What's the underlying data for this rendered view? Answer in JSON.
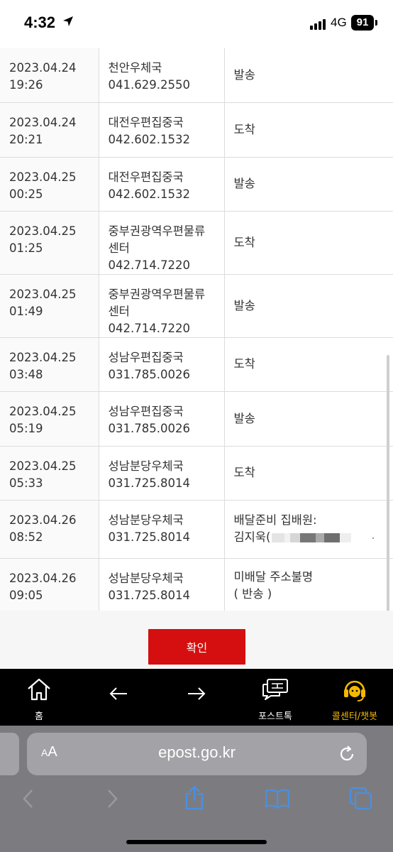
{
  "status_bar": {
    "time": "4:32",
    "network": "4G",
    "battery": "91"
  },
  "rows": [
    {
      "date": "2023.04.24",
      "time": "19:26",
      "office": "천안우체국",
      "office_line2": "",
      "phone": "041.629.2550",
      "status": "발송",
      "status_line2": ""
    },
    {
      "date": "2023.04.24",
      "time": "20:21",
      "office": "대전우편집중국",
      "office_line2": "",
      "phone": "042.602.1532",
      "status": "도착",
      "status_line2": ""
    },
    {
      "date": "2023.04.25",
      "time": "00:25",
      "office": "대전우편집중국",
      "office_line2": "",
      "phone": "042.602.1532",
      "status": "발송",
      "status_line2": ""
    },
    {
      "date": "2023.04.25",
      "time": "01:25",
      "office": "중부권광역우편물류",
      "office_line2": "센터",
      "phone": "042.714.7220",
      "status": "도착",
      "status_line2": ""
    },
    {
      "date": "2023.04.25",
      "time": "01:49",
      "office": "중부권광역우편물류",
      "office_line2": "센터",
      "phone": "042.714.7220",
      "status": "발송",
      "status_line2": ""
    },
    {
      "date": "2023.04.25",
      "time": "03:48",
      "office": "성남우편집중국",
      "office_line2": "",
      "phone": "031.785.0026",
      "status": "도착",
      "status_line2": ""
    },
    {
      "date": "2023.04.25",
      "time": "05:19",
      "office": "성남우편집중국",
      "office_line2": "",
      "phone": "031.785.0026",
      "status": "발송",
      "status_line2": ""
    },
    {
      "date": "2023.04.25",
      "time": "05:33",
      "office": "성남분당우체국",
      "office_line2": "",
      "phone": "031.725.8014",
      "status": "도착",
      "status_line2": ""
    },
    {
      "date": "2023.04.26",
      "time": "08:52",
      "office": "성남분당우체국",
      "office_line2": "",
      "phone": "031.725.8014",
      "status": "배달준비 집배원:",
      "status_line2": "김지욱("
    },
    {
      "date": "2023.04.26",
      "time": "09:05",
      "office": "성남분당우체국",
      "office_line2": "",
      "phone": "031.725.8014",
      "status": "미배달 주소불명",
      "status_line2": "( 반송 )"
    }
  ],
  "confirm_label": "확인",
  "nav": {
    "home": "홈",
    "posttalk": "포스트톡",
    "callcenter": "콜센터/챗봇"
  },
  "safari": {
    "aa_small": "A",
    "aa_large": "A",
    "url": "epost.go.kr"
  },
  "colors": {
    "accent_red": "#d50f0f",
    "callcenter_yellow": "#f5b800",
    "safari_blue": "#4a90e2"
  }
}
